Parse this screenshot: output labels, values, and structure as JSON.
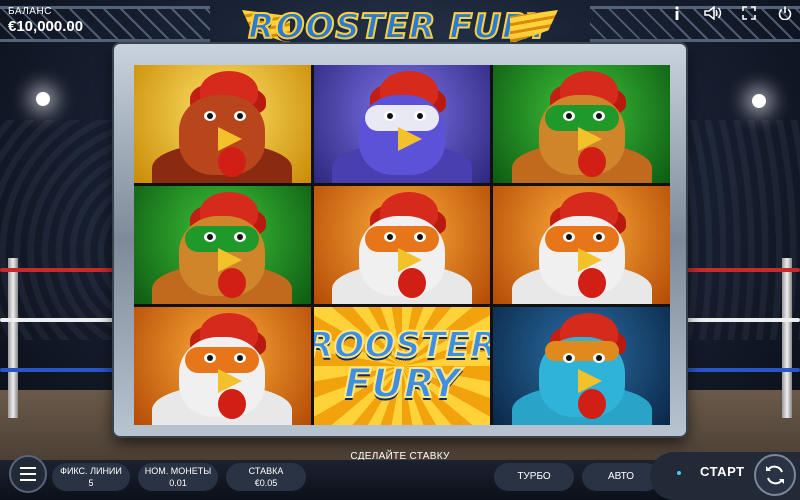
{
  "header": {
    "balance_label": "БАЛАНС",
    "balance_value": "€10,000.00",
    "logo_text": "ROOSTER FURY",
    "icons": [
      "info-icon",
      "sound-icon",
      "fullscreen-icon",
      "power-icon"
    ]
  },
  "reels": [
    {
      "symbol": "red-rooster",
      "background": "yellow"
    },
    {
      "symbol": "purple-masked-rooster",
      "background": "purple"
    },
    {
      "symbol": "green-masked-rooster",
      "background": "green"
    },
    {
      "symbol": "green-masked-rooster",
      "background": "green"
    },
    {
      "symbol": "orange-masked-rooster",
      "background": "orange"
    },
    {
      "symbol": "orange-masked-rooster",
      "background": "orange"
    },
    {
      "symbol": "orange-masked-rooster",
      "background": "orange"
    },
    {
      "symbol": "rooster-fury-wild",
      "background": "gold",
      "text_top": "ROOSTER",
      "text_bottom": "FURY"
    },
    {
      "symbol": "blue-rooster",
      "background": "blue"
    }
  ],
  "prompt": "СДЕЛАЙТЕ СТАВКУ",
  "controls": {
    "lines_label": "ФИКС. ЛИНИИ",
    "lines_value": "5",
    "coin_label": "НОМ. МОНЕТЫ",
    "coin_value": "0.01",
    "bet_label": "СТАВКА",
    "bet_value": "€0.05",
    "turbo_label": "ТУРБО",
    "auto_label": "АВТО",
    "start_label": "СТАРТ"
  },
  "colors": {
    "accent": "#49c9ff",
    "logo_blue": "#2a7ad8",
    "logo_gold": "#ffd23a"
  }
}
